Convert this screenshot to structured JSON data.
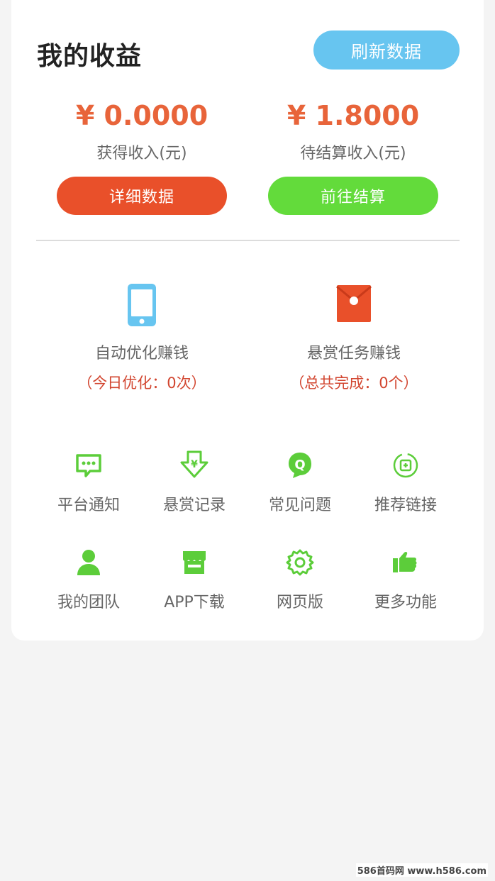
{
  "header": {
    "title": "我的收益",
    "refresh_label": "刷新数据"
  },
  "earnings": {
    "received": {
      "amount": "¥ 0.0000",
      "label": "获得收入(元)"
    },
    "pending": {
      "amount": "¥ 1.8000",
      "label": "待结算收入(元)"
    },
    "detail_label": "详细数据",
    "settle_label": "前往结算"
  },
  "features": [
    {
      "label": "自动优化赚钱",
      "sub": "（今日优化：0次）",
      "icon": "phone-icon"
    },
    {
      "label": "悬赏任务赚钱",
      "sub": "（总共完成：0个）",
      "icon": "red-envelope-icon"
    }
  ],
  "grid": [
    {
      "label": "平台通知",
      "icon": "message-icon"
    },
    {
      "label": "悬赏记录",
      "icon": "yuan-download-icon"
    },
    {
      "label": "常见问题",
      "icon": "question-icon"
    },
    {
      "label": "推荐链接",
      "icon": "invite-icon"
    },
    {
      "label": "我的团队",
      "icon": "user-icon"
    },
    {
      "label": "APP下载",
      "icon": "store-icon"
    },
    {
      "label": "网页版",
      "icon": "gear-icon"
    },
    {
      "label": "更多功能",
      "icon": "hand-icon"
    }
  ],
  "watermark": "586首码网 www.h586.com",
  "colors": {
    "accent_orange": "#e8643a",
    "blue": "#67c5f0",
    "green": "#63db3b",
    "red": "#e9502a",
    "icon_green": "#5ccd3a"
  }
}
